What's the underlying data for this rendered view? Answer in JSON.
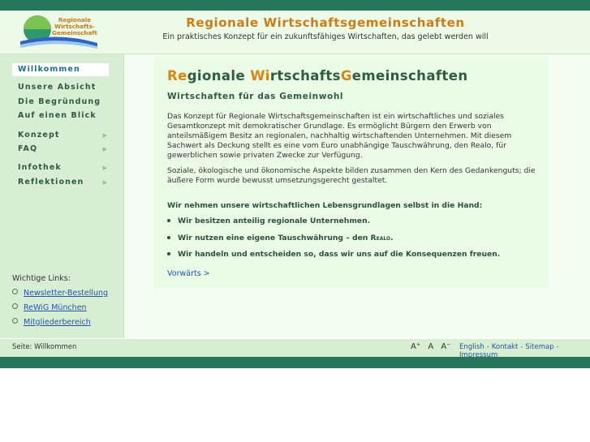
{
  "header": {
    "logo_lines": [
      "Regionale",
      "Wirtschafts-",
      "Gemeinschaft"
    ],
    "title": "Regionale Wirtschaftsgemeinschaften",
    "tagline": "Ein praktisches Konzept für ein zukunftsfähiges Wirtschaften, das gelebt werden will"
  },
  "sidebar": {
    "items": [
      {
        "label": "Willkommen"
      },
      {
        "label": "Unsere Absicht"
      },
      {
        "label": "Die Begründung"
      },
      {
        "label": "Auf einen Blick"
      },
      {
        "label": "Konzept"
      },
      {
        "label": "FAQ"
      },
      {
        "label": "Infothek"
      },
      {
        "label": "Reflektionen"
      }
    ],
    "links_label": "Wichtige Links:",
    "links": [
      "Newsletter-Bestellung",
      "ReWiG München",
      "Mitgliederbereich"
    ]
  },
  "main": {
    "title_parts": [
      "Re",
      "gionale ",
      "Wi",
      "rtschafts",
      "G",
      "emeinschaften"
    ],
    "subtitle": "Wirtschaften für das Gemeinwohl",
    "para1": "Das Konzept für Regionale Wirtschaftsgemeinschaften ist ein wirtschaftliches und soziales Gesamtkonzept mit demokratischer Grundlage. Es ermöglicht Bürgern den Erwerb von anteilsmäßigem Besitz an regionalen, nachhaltig wirtschaftenden Unternehmen. Mit diesem Sachwert als Deckung stellt es eine vom Euro unabhängige Tauschwährung, den Realo, für gewerblichen sowie privaten Zwecke zur Verfügung.",
    "para2": "Soziale, ökologische und ökonomische Aspekte bilden zusammen den Kern des Gedankenguts; die äußere Form wurde bewusst umsetzungsgerecht gestaltet.",
    "intro": "Wir nehmen unsere wirtschaftlichen Lebensgrundlagen selbst in die Hand:",
    "bullet1": "Wir besitzen anteilig regionale Unternehmen.",
    "bullet2_before": "Wir nutzen eine eigene Tauschwährung – den ",
    "bullet2_realo": "Realo",
    "bullet2_after": ".",
    "bullet3": "Wir handeln und entscheiden so, dass wir uns auf die Konsequenzen freuen.",
    "next": "Vorwärts >"
  },
  "footer": {
    "page_info": "Seite: Willkommen",
    "font_sizes": [
      "A⁺",
      "A",
      "A⁻"
    ],
    "links": [
      "English",
      "Kontakt",
      "Sitemap",
      "Impressum"
    ],
    "separator": "-"
  },
  "colors": {
    "bar": "#25765a",
    "header_bg": "#ecfbe7",
    "sidebar_bg": "#d8eed4",
    "accent_orange": "#d17a12",
    "text_green": "#2f5b43",
    "link_blue": "#2255aa"
  }
}
